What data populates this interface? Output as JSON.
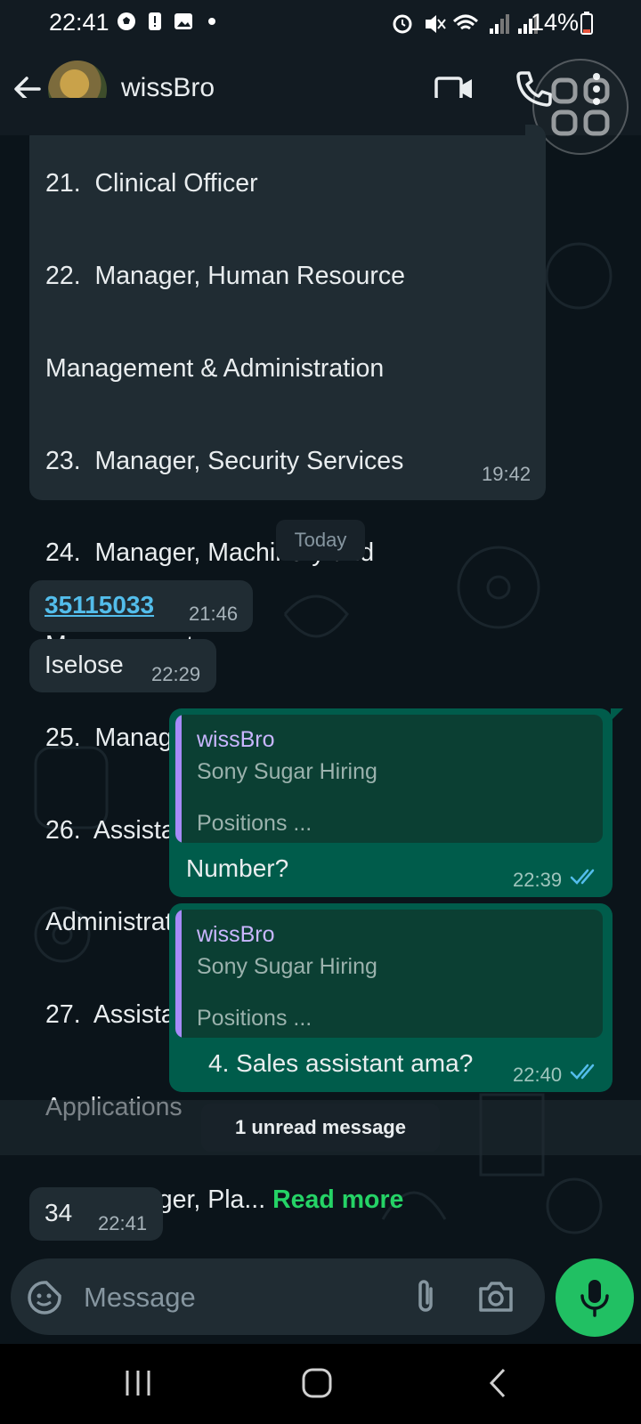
{
  "status": {
    "time": "22:41",
    "battery": "14%"
  },
  "header": {
    "contact_name": "wissBro"
  },
  "messages": {
    "list_message": {
      "partial_top": "21.  Clinical Officer",
      "lines": [
        "22.  Manager, Human Resource",
        "Management & Administration",
        "23.  Manager, Security Services",
        "24.  Manager, Machinery and",
        "Management",
        "25.  Manager, Production",
        "26.  Assistant Manager, Network &",
        "Administration",
        "27.  Assistant Manager, Business",
        "Applications"
      ],
      "last_line": "28.  Manager, Pla...",
      "read_more": "Read more",
      "time": "19:42"
    },
    "date_chip": "Today",
    "link_message": {
      "text": "35115033",
      "time": "21:46"
    },
    "iselose_message": {
      "text": "Iselose",
      "time": "22:29"
    },
    "reply1": {
      "quote_name": "wissBro",
      "quote_title": "Sony Sugar Hiring",
      "quote_text": "Positions ...",
      "text": "Number?",
      "time": "22:39"
    },
    "reply2": {
      "quote_name": "wissBro",
      "quote_title": "Sony Sugar Hiring",
      "quote_text": "Positions ...",
      "text": "4. Sales assistant ama?",
      "time": "22:40"
    },
    "unread_banner": "1 unread message",
    "last_incoming": {
      "text": "34",
      "time": "22:41"
    }
  },
  "composer": {
    "placeholder": "Message"
  },
  "colors": {
    "incoming": "#202c33",
    "outgoing": "#005c4b",
    "accent": "#25d366",
    "read_ticks": "#53bdeb"
  }
}
